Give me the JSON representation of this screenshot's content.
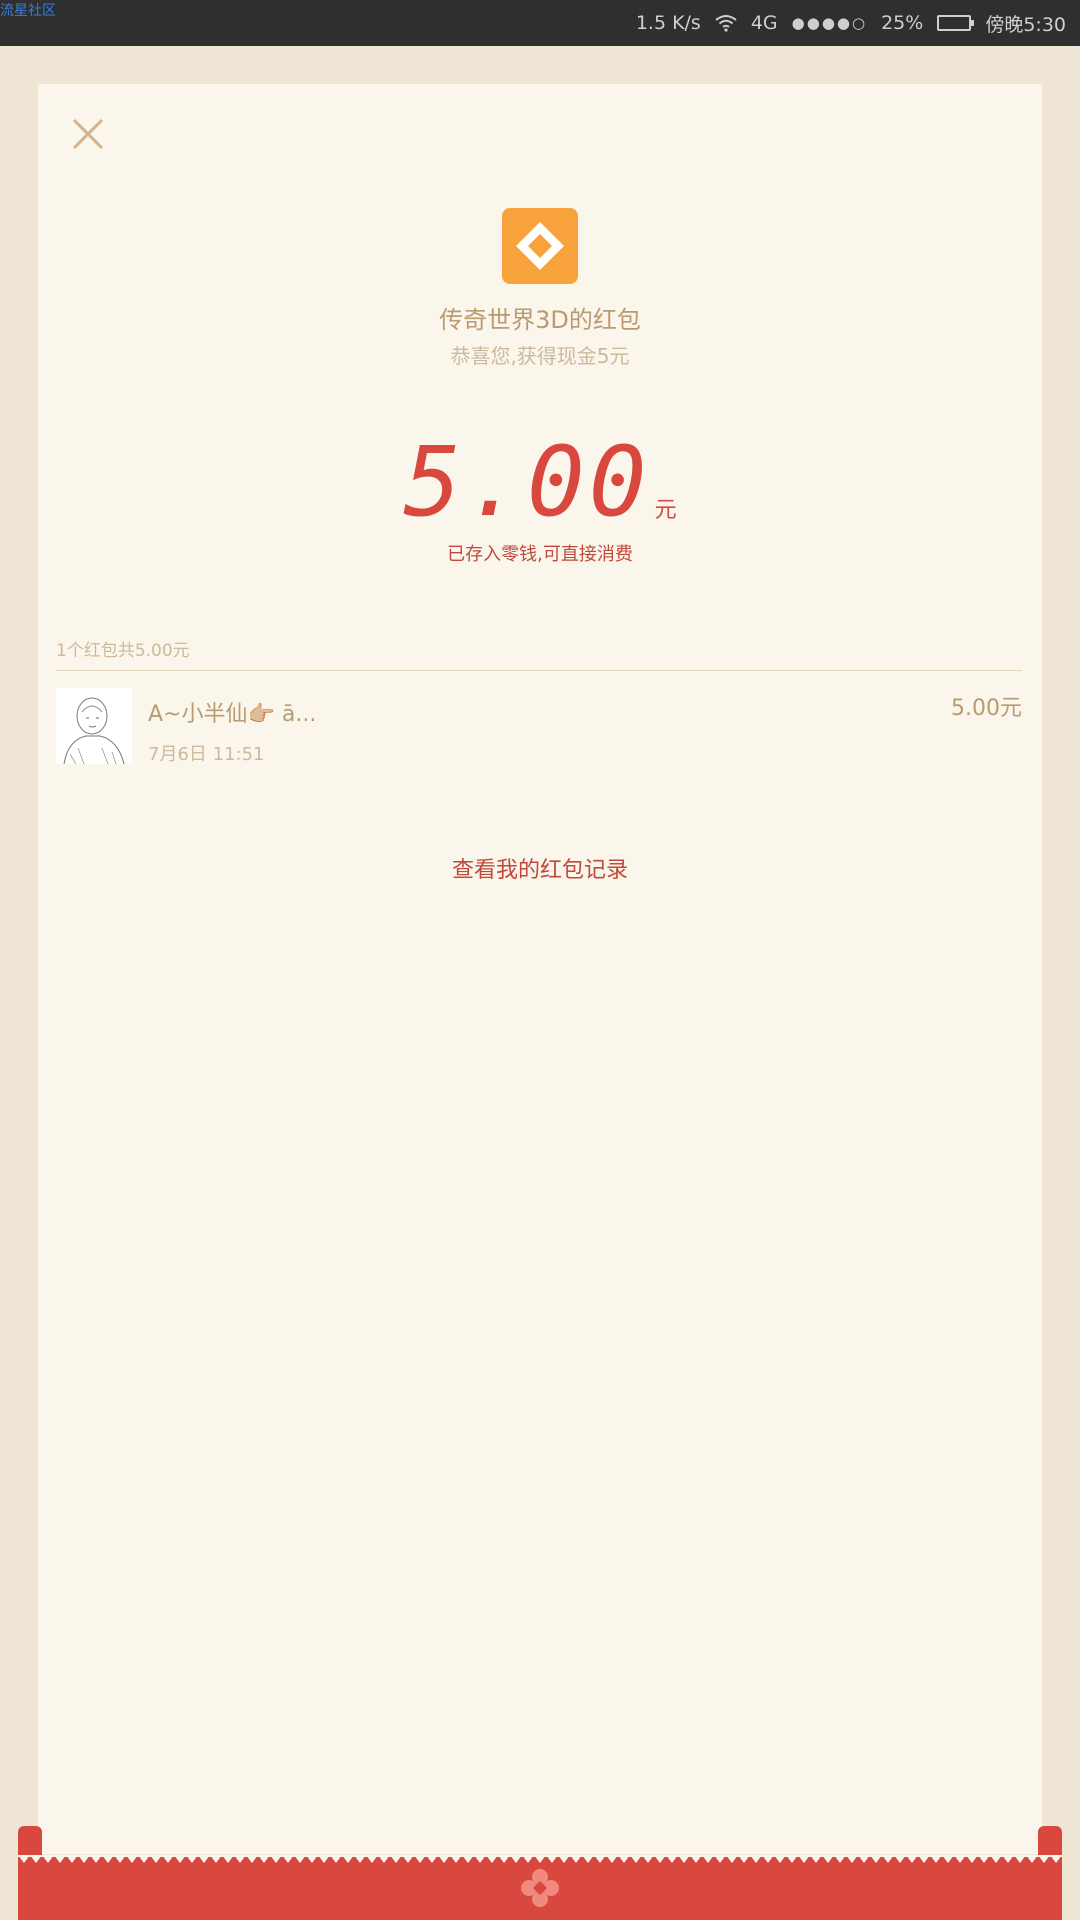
{
  "watermark": "流星社区",
  "status_bar": {
    "net_speed": "1.5 K/s",
    "network": "4G",
    "signal_dots": "●●●●○",
    "battery": "25%",
    "time": "傍晚5:30",
    "wifi_icon": "wifi-icon",
    "battery_icon": "battery-icon"
  },
  "colors": {
    "background": "#efe6d6",
    "card": "#fbf6eb",
    "accent_red": "#d9483e",
    "logo_orange": "#f7a23a",
    "text_tan": "#b99b72"
  },
  "header": {
    "close_icon": "close-icon",
    "logo_icon": "app-logo-icon",
    "sender_title": "传奇世界3D的红包",
    "greeting": "恭喜您,获得现金5元"
  },
  "amount": {
    "value": "5.00",
    "unit": "元",
    "note": "已存入零钱,可直接消费"
  },
  "summary": "1个红包共5.00元",
  "records": [
    {
      "name": "A~小半仙👉🏼 ā...",
      "time": "7月6日 11:51",
      "amount": "5.00元"
    }
  ],
  "history_link": "查看我的红包记录",
  "footer": {
    "emblem_icon": "flower-emblem-icon"
  }
}
